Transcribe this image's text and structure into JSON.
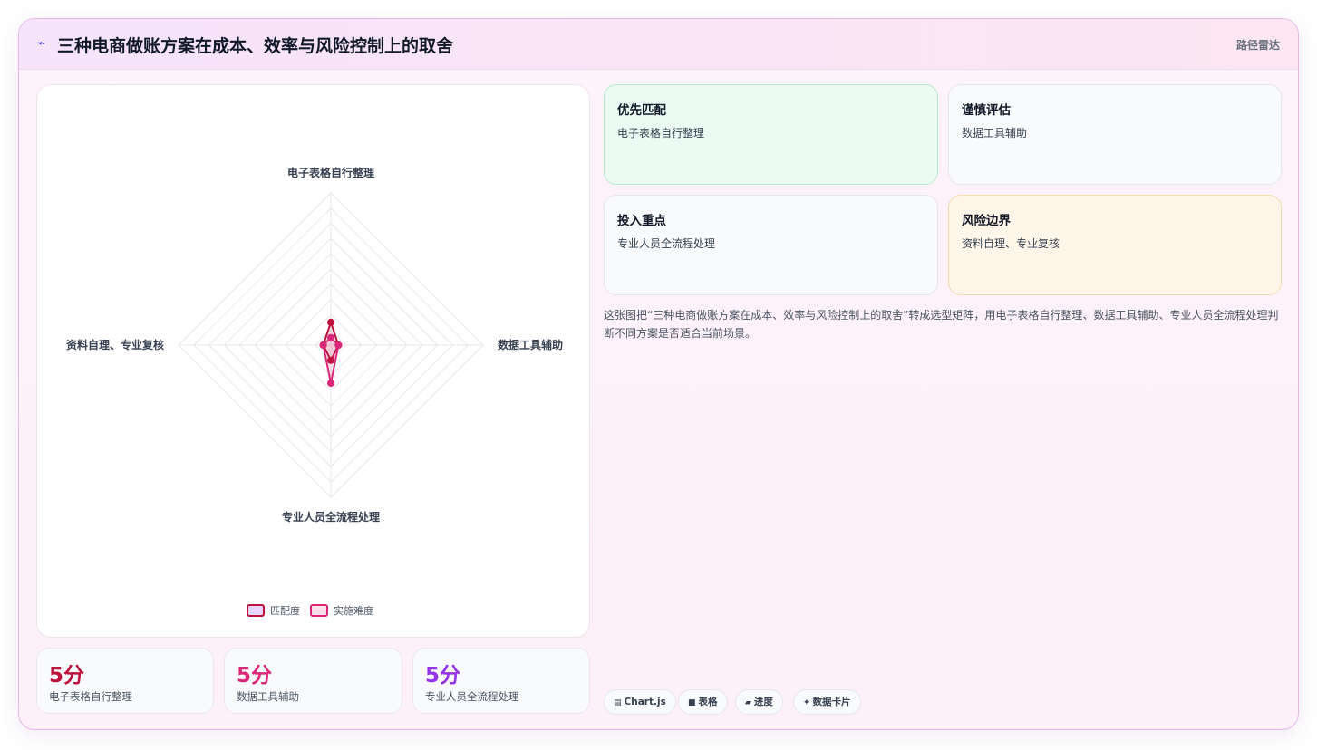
{
  "header": {
    "icon": "line-chart-icon",
    "title": "三种电商做账方案在成本、效率与风险控制上的取舍",
    "tag": "路径雷达"
  },
  "chart_data": {
    "type": "radar",
    "axes": [
      "电子表格自行整理",
      "数据工具辅助",
      "专业人员全流程处理",
      "资料自理、专业复核"
    ],
    "rmax": 10,
    "rings": 10,
    "grid": true,
    "legend_position": "bottom",
    "series": [
      {
        "name": "匹配度",
        "values": [
          1.5,
          0.5,
          1.0,
          0.5
        ],
        "color": "#be123c"
      },
      {
        "name": "实施难度",
        "values": [
          0.5,
          0.5,
          2.5,
          0.5
        ],
        "color": "#db2777"
      }
    ]
  },
  "stats": [
    {
      "value": "5分",
      "label": "电子表格自行整理",
      "color": "#be123c"
    },
    {
      "value": "5分",
      "label": "数据工具辅助",
      "color": "#db2777"
    },
    {
      "value": "5分",
      "label": "专业人员全流程处理",
      "color": "#9333ea"
    }
  ],
  "cards": [
    {
      "heading": "优先匹配",
      "text": "电子表格自行整理"
    },
    {
      "heading": "谨慎评估",
      "text": "数据工具辅助"
    },
    {
      "heading": "投入重点",
      "text": "专业人员全流程处理"
    },
    {
      "heading": "风险边界",
      "text": "资料自理、专业复核"
    }
  ],
  "description": "这张图把“三种电商做账方案在成本、效率与风险控制上的取舍”转成选型矩阵，用电子表格自行整理、数据工具辅助、专业人员全流程处理判断不同方案是否适合当前场景。",
  "chips": [
    {
      "icon": "chart-icon",
      "glyph": "▤",
      "label": "Chart.js"
    },
    {
      "icon": "table-icon",
      "glyph": "■",
      "label": "表格"
    },
    {
      "icon": "progress-icon",
      "glyph": "▰",
      "label": "进度"
    },
    {
      "icon": "sparkle-icon",
      "glyph": "✦",
      "label": "数据卡片"
    }
  ],
  "colors": {
    "accent": "#be123c",
    "card_green_bg": "#ebfbf3",
    "card_orange_bg": "#fff5e9"
  }
}
